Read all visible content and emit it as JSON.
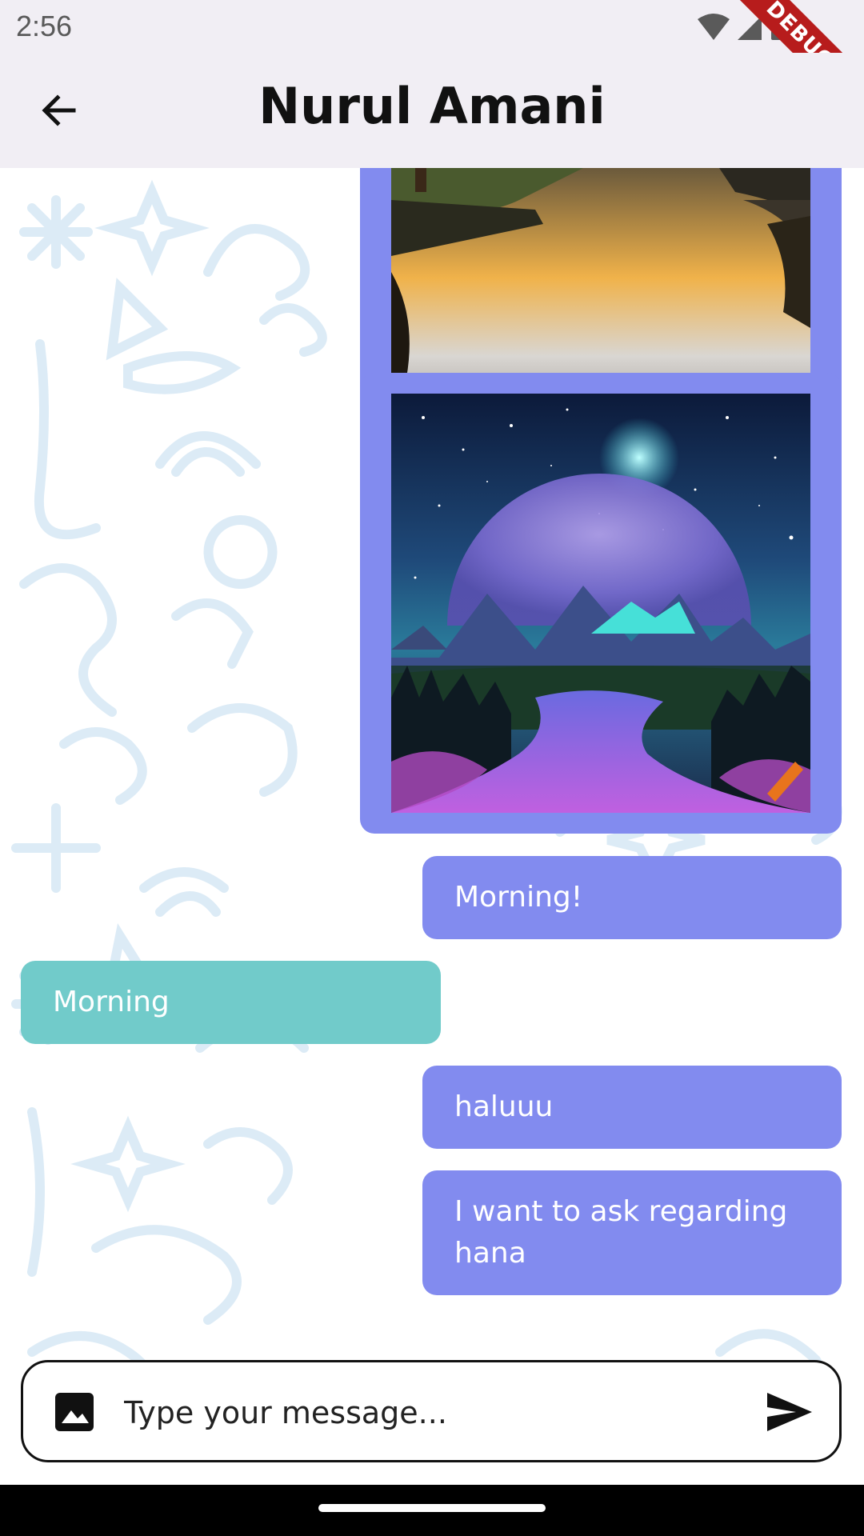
{
  "status_bar": {
    "time": "2:56",
    "debug_label": "DEBUG"
  },
  "header": {
    "title": "Nurul Amani"
  },
  "messages": {
    "m1": "Morning!",
    "m2": "Morning",
    "m3": "haluuu",
    "m4": "I want to ask regarding hana"
  },
  "composer": {
    "placeholder": "Type your message..."
  },
  "colors": {
    "outgoing_bubble": "#828bef",
    "incoming_bubble": "#71cbca",
    "app_bar": "#f1eef4",
    "doodle": "#dcebf6"
  },
  "icons": [
    "arrow-back-icon",
    "image-icon",
    "send-icon",
    "wifi-icon",
    "signal-icon",
    "battery-icon"
  ]
}
